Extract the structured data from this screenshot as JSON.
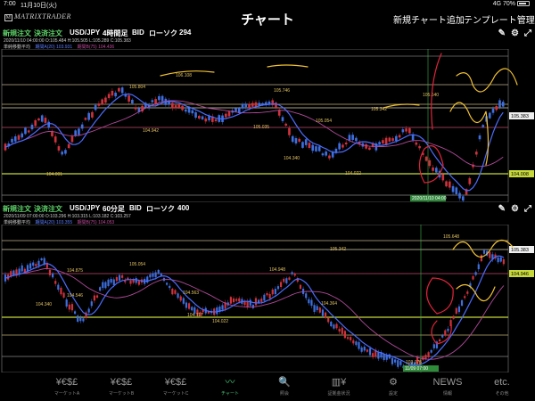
{
  "status": {
    "time": "7:00",
    "date": "11月10日(火)",
    "signal": "4G 70%"
  },
  "nav": {
    "logo": "MATRIXTRADER",
    "title": "チャート",
    "add_chart": "新規チャート追加",
    "template": "テンプレート管理"
  },
  "chart1": {
    "btn_new": "新規注文",
    "btn_settle": "決済注文",
    "pair": "USD/JPY",
    "timeframe": "4時間足",
    "side": "BID",
    "chart_type": "ローソク",
    "count": "294",
    "ohlc": "2020/11/10 04:00:00  O:105.484  H:105.505  L:105.289  C:105.383",
    "indicator_label": "単純移動平均",
    "ma_short": "期間A(20) 103.931",
    "ma_long": "期間B(75) 104.436",
    "price_tag": "105.383",
    "level_tag": "104.008",
    "cursor_time": "2020/11/10 04:00",
    "annotations": [
      "105.804",
      "106.108",
      "105.746",
      "104.942",
      "105.035",
      "105.054",
      "105.342",
      "105.640",
      "104.001",
      "104.340",
      "104.022",
      "103.175"
    ]
  },
  "chart2": {
    "btn_new": "新規注文",
    "btn_settle": "決済注文",
    "pair": "USD/JPY",
    "timeframe": "60分足",
    "side": "BID",
    "chart_type": "ローソク",
    "count": "400",
    "ohlc": "2020/11/09 07:00:00  O:103.296  H:103.315  L:103.182  C:103.257",
    "indicator_label": "単純移動平均",
    "ma_short": "期間A(20) 103.355",
    "ma_long": "期間B(75) 104.053",
    "price_tag": "105.383",
    "level_tag": "104.946",
    "cursor_time": "11/09 07:00",
    "annotations": [
      "104.875",
      "105.054",
      "104.948",
      "104.546",
      "104.563",
      "105.342",
      "105.648",
      "104.340",
      "104.117",
      "104.022",
      "104.364",
      "103.175"
    ]
  },
  "tabs": [
    {
      "icon": "¥€$£",
      "label": "マーケットA",
      "active": false
    },
    {
      "icon": "¥€$£",
      "label": "マーケットB",
      "active": false
    },
    {
      "icon": "¥€$£",
      "label": "マーケットC",
      "active": false
    },
    {
      "icon": "〰",
      "label": "チャート",
      "active": true
    },
    {
      "icon": "🔍",
      "label": "照会",
      "active": false
    },
    {
      "icon": "▥¥",
      "label": "証拠金状況",
      "active": false
    },
    {
      "icon": "⚙",
      "label": "設定",
      "active": false
    },
    {
      "icon": "NEWS",
      "label": "情報",
      "active": false
    },
    {
      "icon": "etc.",
      "label": "その他",
      "active": false
    }
  ],
  "colors": {
    "accent": "#44d07a",
    "bull": "#d0323c",
    "bear": "#3d6fe0",
    "ma_short": "#4a6cff",
    "ma_long": "#b04a9a",
    "annotation": "#f0c030"
  }
}
